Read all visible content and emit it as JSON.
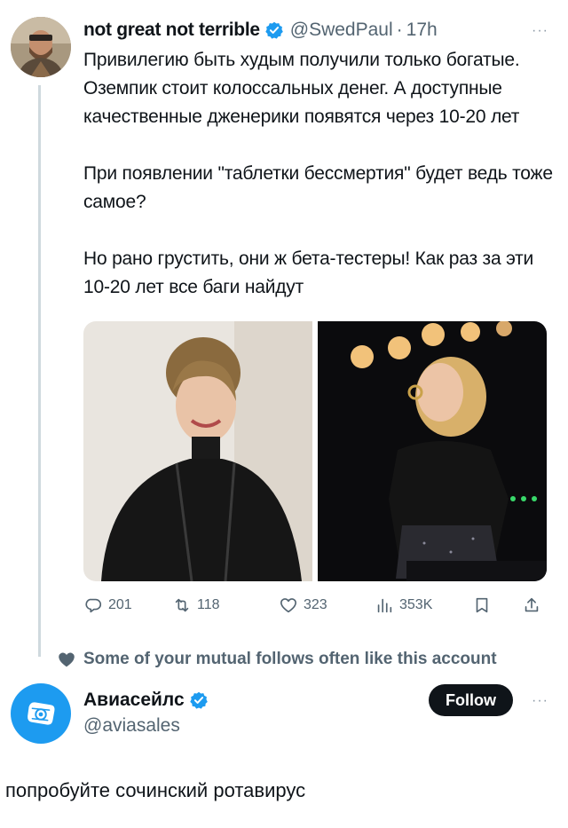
{
  "tweet": {
    "display_name": "not great not terrible",
    "handle": "@SwedPaul",
    "separator": "·",
    "time": "17h",
    "more": "···",
    "paragraphs": [
      "Привилегию быть худым получили только богатые. Оземпик стоит колоссальных денег. А доступные качественные дженерики появятся через 10-20 лет",
      "При появлении \"таблетки бессмертия\" будет ведь тоже самое?",
      "Но рано грустить, они ж бета-тестеры! Как раз за эти 10-20 лет все баги найдут"
    ],
    "stats": {
      "replies": "201",
      "retweets": "118",
      "likes": "323",
      "views": "353K"
    }
  },
  "social_context": "Some of your mutual follows often like this account",
  "suggested_account": {
    "name": "Авиасейлс",
    "handle": "@aviasales",
    "follow_label": "Follow",
    "more": "···"
  },
  "caption": "попробуйте сочинский ротавирус",
  "colors": {
    "verified_blue": "#1d9bf0",
    "secondary_text": "#536471",
    "follow_bg": "#0f1419"
  }
}
